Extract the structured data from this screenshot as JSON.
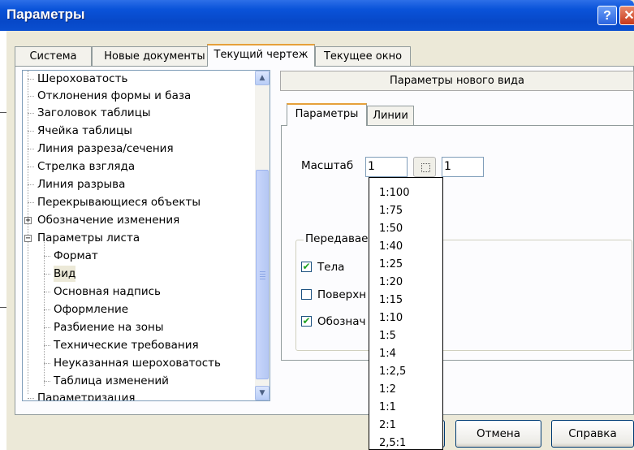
{
  "window": {
    "title": "Параметры",
    "help_button": "?",
    "close_button": "✕"
  },
  "main_tabs": [
    {
      "label": "Система"
    },
    {
      "label": "Новые документы"
    },
    {
      "label": "Текущий чертеж"
    },
    {
      "label": "Текущее окно"
    }
  ],
  "tree": {
    "items": [
      {
        "label": "Шероховатость"
      },
      {
        "label": "Отклонения формы и база"
      },
      {
        "label": "Заголовок таблицы"
      },
      {
        "label": "Ячейка таблицы"
      },
      {
        "label": "Линия разреза/сечения"
      },
      {
        "label": "Стрелка взгляда"
      },
      {
        "label": "Линия разрыва"
      },
      {
        "label": "Перекрывающиеся объекты"
      },
      {
        "label": "Обозначение изменения",
        "expander": "+"
      },
      {
        "label": "Параметры листа",
        "expander": "−"
      },
      {
        "label": "Формат"
      },
      {
        "label": "Вид"
      },
      {
        "label": "Основная надпись"
      },
      {
        "label": "Оформление"
      },
      {
        "label": "Разбиение на зоны"
      },
      {
        "label": "Технические требования"
      },
      {
        "label": "Неуказанная шероховатость"
      },
      {
        "label": "Таблица изменений"
      },
      {
        "label": "Параметризация"
      }
    ]
  },
  "panel": {
    "header": "Параметры нового вида",
    "tabs": [
      {
        "label": "Параметры"
      },
      {
        "label": "Линии"
      }
    ],
    "scale_label": "Масштаб",
    "scale_left": "1",
    "scale_right": "1",
    "group_title": "Передавае",
    "checkboxes": [
      {
        "label": "Тела",
        "checked": true
      },
      {
        "label": "Поверхн",
        "checked": false
      },
      {
        "label": "Обознач",
        "checked": true
      }
    ]
  },
  "dropdown": {
    "options": [
      "1:100",
      "1:75",
      "1:50",
      "1:40",
      "1:25",
      "1:20",
      "1:15",
      "1:10",
      "1:5",
      "1:4",
      "1:2,5",
      "1:2",
      "1:1",
      "2:1",
      "2,5:1"
    ]
  },
  "buttons": {
    "cancel": "Отмена",
    "help": "Справка"
  }
}
